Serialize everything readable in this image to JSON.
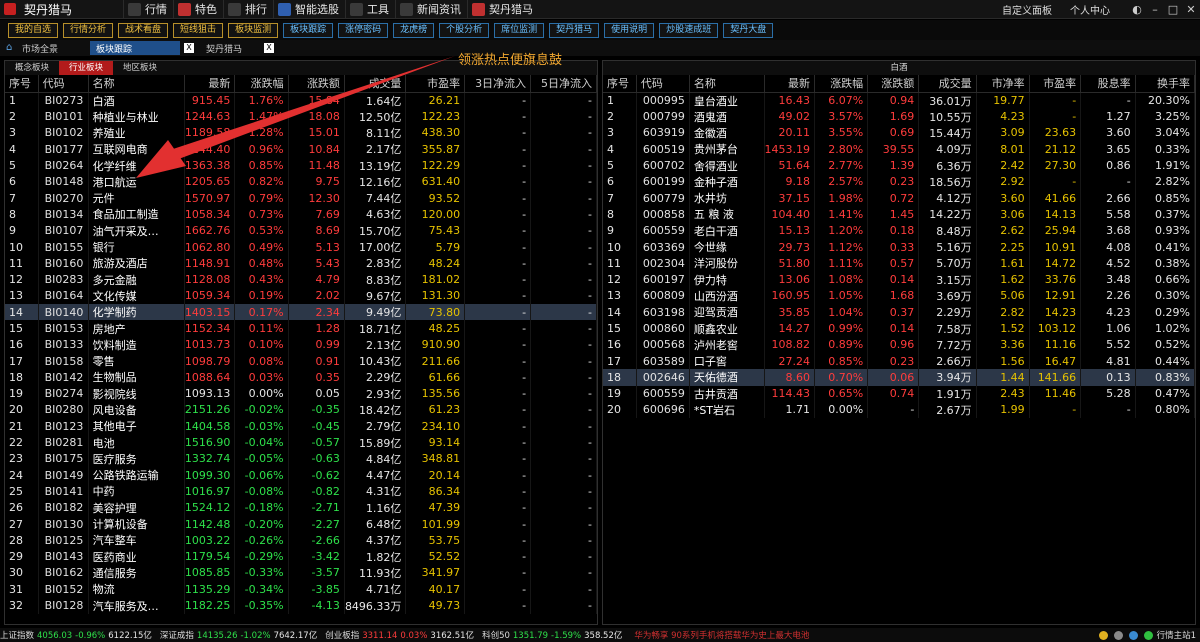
{
  "app": {
    "title": "契丹猎马"
  },
  "menu": [
    {
      "label": "行情",
      "icon": "chart-icon",
      "color": "#3a3a3a"
    },
    {
      "label": "特色",
      "icon": "star-icon",
      "color": "#c03030"
    },
    {
      "label": "排行",
      "icon": "rank-icon",
      "color": "#3a3a3a"
    },
    {
      "label": "智能选股",
      "icon": "smart-pick-icon",
      "color": "#2f5fb0"
    },
    {
      "label": "工具",
      "icon": "tool-icon",
      "color": "#3a3a3a"
    },
    {
      "label": "新闻资讯",
      "icon": "news-icon",
      "color": "#3a3a3a"
    },
    {
      "label": "契丹猎马",
      "icon": "brand-icon",
      "color": "#c03030"
    }
  ],
  "topright": {
    "custom_panel": "自定义面板",
    "personal": "个人中心"
  },
  "toolbar": [
    {
      "label": "我的自选",
      "style": "gold"
    },
    {
      "label": "行情分析",
      "style": "gold"
    },
    {
      "label": "战术看盘",
      "style": "gold"
    },
    {
      "label": "短线狙击",
      "style": "gold"
    },
    {
      "label": "板块监测",
      "style": "gold"
    },
    {
      "label": "板块跟踪",
      "style": "blue"
    },
    {
      "label": "涨停密码",
      "style": "blue"
    },
    {
      "label": "龙虎榜",
      "style": "blue"
    },
    {
      "label": "个股分析",
      "style": "blue"
    },
    {
      "label": "席位监测",
      "style": "blue"
    },
    {
      "label": "契丹猎马",
      "style": "blue"
    },
    {
      "label": "使用说明",
      "style": "blue"
    },
    {
      "label": "炒股速成班",
      "style": "blue"
    },
    {
      "label": "契丹大盘",
      "style": "blue"
    }
  ],
  "tabs": {
    "home": "市场全景",
    "active": "板块跟踪",
    "other": "契丹猎马"
  },
  "annotation": "领涨热点便旗息鼓",
  "left": {
    "subtabs": [
      "概念板块",
      "行业板块",
      "地区板块"
    ],
    "active_subtab": 1,
    "headers": [
      "序号",
      "代码",
      "名称",
      "最新",
      "涨跌幅",
      "涨跌额",
      "成交量",
      "市盈率",
      "3日净流入",
      "5日净流入"
    ],
    "rows": [
      [
        "1",
        "BI0273",
        "白酒",
        "915.45",
        "1.76%",
        "15.84",
        "1.64亿",
        "26.21",
        "-",
        "-"
      ],
      [
        "2",
        "BI0101",
        "种植业与林业",
        "1244.63",
        "1.47%",
        "18.08",
        "12.50亿",
        "122.23",
        "-",
        "-"
      ],
      [
        "3",
        "BI0102",
        "养殖业",
        "1189.58",
        "1.28%",
        "15.01",
        "8.11亿",
        "438.30",
        "-",
        "-"
      ],
      [
        "4",
        "BI0177",
        "互联网电商",
        "1144.40",
        "0.96%",
        "10.84",
        "2.17亿",
        "355.87",
        "-",
        "-"
      ],
      [
        "5",
        "BI0264",
        "化学纤维",
        "1363.38",
        "0.85%",
        "11.48",
        "13.19亿",
        "122.29",
        "-",
        "-"
      ],
      [
        "6",
        "BI0148",
        "港口航运",
        "1205.65",
        "0.82%",
        "9.75",
        "12.16亿",
        "631.40",
        "-",
        "-"
      ],
      [
        "7",
        "BI0270",
        "元件",
        "1570.97",
        "0.79%",
        "12.30",
        "7.44亿",
        "93.52",
        "-",
        "-"
      ],
      [
        "8",
        "BI0134",
        "食品加工制造",
        "1058.34",
        "0.73%",
        "7.69",
        "4.63亿",
        "120.00",
        "-",
        "-"
      ],
      [
        "9",
        "BI0107",
        "油气开采及…",
        "1662.76",
        "0.53%",
        "8.69",
        "15.70亿",
        "75.43",
        "-",
        "-"
      ],
      [
        "10",
        "BI0155",
        "银行",
        "1062.80",
        "0.49%",
        "5.13",
        "17.00亿",
        "5.79",
        "-",
        "-"
      ],
      [
        "11",
        "BI0160",
        "旅游及酒店",
        "1148.91",
        "0.48%",
        "5.43",
        "2.83亿",
        "48.24",
        "-",
        "-"
      ],
      [
        "12",
        "BI0283",
        "多元金融",
        "1128.08",
        "0.43%",
        "4.79",
        "8.83亿",
        "181.02",
        "-",
        "-"
      ],
      [
        "13",
        "BI0164",
        "文化传媒",
        "1059.34",
        "0.19%",
        "2.02",
        "9.67亿",
        "131.30",
        "-",
        "-"
      ],
      [
        "14",
        "BI0140",
        "化学制药",
        "1403.15",
        "0.17%",
        "2.34",
        "9.49亿",
        "73.80",
        "-",
        "-"
      ],
      [
        "15",
        "BI0153",
        "房地产",
        "1152.34",
        "0.11%",
        "1.28",
        "18.71亿",
        "48.25",
        "-",
        "-"
      ],
      [
        "16",
        "BI0133",
        "饮料制造",
        "1013.73",
        "0.10%",
        "0.99",
        "2.13亿",
        "910.90",
        "-",
        "-"
      ],
      [
        "17",
        "BI0158",
        "零售",
        "1098.79",
        "0.08%",
        "0.91",
        "10.43亿",
        "211.66",
        "-",
        "-"
      ],
      [
        "18",
        "BI0142",
        "生物制品",
        "1088.64",
        "0.03%",
        "0.35",
        "2.29亿",
        "61.66",
        "-",
        "-"
      ],
      [
        "19",
        "BI0274",
        "影视院线",
        "1093.13",
        "0.00%",
        "0.05",
        "2.93亿",
        "135.56",
        "-",
        "-"
      ],
      [
        "20",
        "BI0280",
        "风电设备",
        "2151.26",
        "-0.02%",
        "-0.35",
        "18.42亿",
        "61.23",
        "-",
        "-"
      ],
      [
        "21",
        "BI0123",
        "其他电子",
        "1404.58",
        "-0.03%",
        "-0.45",
        "2.79亿",
        "234.10",
        "-",
        "-"
      ],
      [
        "22",
        "BI0281",
        "电池",
        "1516.90",
        "-0.04%",
        "-0.57",
        "15.89亿",
        "93.14",
        "-",
        "-"
      ],
      [
        "23",
        "BI0175",
        "医疗服务",
        "1332.74",
        "-0.05%",
        "-0.63",
        "4.84亿",
        "348.81",
        "-",
        "-"
      ],
      [
        "24",
        "BI0149",
        "公路铁路运输",
        "1099.30",
        "-0.06%",
        "-0.62",
        "4.47亿",
        "20.14",
        "-",
        "-"
      ],
      [
        "25",
        "BI0141",
        "中药",
        "1016.97",
        "-0.08%",
        "-0.82",
        "4.31亿",
        "86.34",
        "-",
        "-"
      ],
      [
        "26",
        "BI0182",
        "美容护理",
        "1524.12",
        "-0.18%",
        "-2.71",
        "1.16亿",
        "47.39",
        "-",
        "-"
      ],
      [
        "27",
        "BI0130",
        "计算机设备",
        "1142.48",
        "-0.20%",
        "-2.27",
        "6.48亿",
        "101.99",
        "-",
        "-"
      ],
      [
        "28",
        "BI0125",
        "汽车整车",
        "1003.22",
        "-0.26%",
        "-2.66",
        "4.37亿",
        "53.75",
        "-",
        "-"
      ],
      [
        "29",
        "BI0143",
        "医药商业",
        "1179.54",
        "-0.29%",
        "-3.42",
        "1.82亿",
        "52.52",
        "-",
        "-"
      ],
      [
        "30",
        "BI0162",
        "通信服务",
        "1085.85",
        "-0.33%",
        "-3.57",
        "11.93亿",
        "341.97",
        "-",
        "-"
      ],
      [
        "31",
        "BI0152",
        "物流",
        "1135.29",
        "-0.34%",
        "-3.85",
        "4.71亿",
        "40.17",
        "-",
        "-"
      ],
      [
        "32",
        "BI0128",
        "汽车服务及…",
        "1182.25",
        "-0.35%",
        "-4.13",
        "8496.33万",
        "49.73",
        "-",
        "-"
      ]
    ],
    "selected_row": 13
  },
  "right": {
    "title": "白酒",
    "headers": [
      "序号",
      "代码",
      "名称",
      "最新",
      "涨跌幅",
      "涨跌额",
      "成交量",
      "市净率",
      "市盈率",
      "股息率",
      "换手率"
    ],
    "rows": [
      [
        "1",
        "000995",
        "皇台酒业",
        "16.43",
        "6.07%",
        "0.94",
        "36.01万",
        "19.77",
        "-",
        "-",
        "20.30%"
      ],
      [
        "2",
        "000799",
        "酒鬼酒",
        "49.02",
        "3.57%",
        "1.69",
        "10.55万",
        "4.23",
        "-",
        "1.27",
        "3.25%"
      ],
      [
        "3",
        "603919",
        "金徽酒",
        "20.11",
        "3.55%",
        "0.69",
        "15.44万",
        "3.09",
        "23.63",
        "3.60",
        "3.04%"
      ],
      [
        "4",
        "600519",
        "贵州茅台",
        "1453.19",
        "2.80%",
        "39.55",
        "4.09万",
        "8.01",
        "21.12",
        "3.65",
        "0.33%"
      ],
      [
        "5",
        "600702",
        "舍得酒业",
        "51.64",
        "2.77%",
        "1.39",
        "6.36万",
        "2.42",
        "27.30",
        "0.86",
        "1.91%"
      ],
      [
        "6",
        "600199",
        "金种子酒",
        "9.18",
        "2.57%",
        "0.23",
        "18.56万",
        "2.92",
        "-",
        "-",
        "2.82%"
      ],
      [
        "7",
        "600779",
        "水井坊",
        "37.15",
        "1.98%",
        "0.72",
        "4.12万",
        "3.60",
        "41.66",
        "2.66",
        "0.85%"
      ],
      [
        "8",
        "000858",
        "五 粮 液",
        "104.40",
        "1.41%",
        "1.45",
        "14.22万",
        "3.06",
        "14.13",
        "5.58",
        "0.37%"
      ],
      [
        "9",
        "600559",
        "老白干酒",
        "15.13",
        "1.20%",
        "0.18",
        "8.48万",
        "2.62",
        "25.94",
        "3.68",
        "0.93%"
      ],
      [
        "10",
        "603369",
        "今世缘",
        "29.73",
        "1.12%",
        "0.33",
        "5.16万",
        "2.25",
        "10.91",
        "4.08",
        "0.41%"
      ],
      [
        "11",
        "002304",
        "洋河股份",
        "51.80",
        "1.11%",
        "0.57",
        "5.70万",
        "1.61",
        "14.72",
        "4.52",
        "0.38%"
      ],
      [
        "12",
        "600197",
        "伊力特",
        "13.06",
        "1.08%",
        "0.14",
        "3.15万",
        "1.62",
        "33.76",
        "3.48",
        "0.66%"
      ],
      [
        "13",
        "600809",
        "山西汾酒",
        "160.95",
        "1.05%",
        "1.68",
        "3.69万",
        "5.06",
        "12.91",
        "2.26",
        "0.30%"
      ],
      [
        "14",
        "603198",
        "迎驾贡酒",
        "35.85",
        "1.04%",
        "0.37",
        "2.29万",
        "2.82",
        "14.23",
        "4.23",
        "0.29%"
      ],
      [
        "15",
        "000860",
        "顺鑫农业",
        "14.27",
        "0.99%",
        "0.14",
        "7.58万",
        "1.52",
        "103.12",
        "1.06",
        "1.02%"
      ],
      [
        "16",
        "000568",
        "泸州老窖",
        "108.82",
        "0.89%",
        "0.96",
        "7.72万",
        "3.36",
        "11.16",
        "5.52",
        "0.52%"
      ],
      [
        "17",
        "603589",
        "口子窖",
        "27.24",
        "0.85%",
        "0.23",
        "2.66万",
        "1.56",
        "16.47",
        "4.81",
        "0.44%"
      ],
      [
        "18",
        "002646",
        "天佑德酒",
        "8.60",
        "0.70%",
        "0.06",
        "3.94万",
        "1.44",
        "141.66",
        "0.13",
        "0.83%"
      ],
      [
        "19",
        "600559",
        "古井贡酒",
        "114.43",
        "0.65%",
        "0.74",
        "1.91万",
        "2.43",
        "11.46",
        "5.28",
        "0.47%"
      ],
      [
        "20",
        "600696",
        "*ST岩石",
        "1.71",
        "0.00%",
        "-",
        "2.67万",
        "1.99",
        "-",
        "-",
        "0.80%"
      ]
    ],
    "selected_row": 17
  },
  "statusbar": [
    {
      "name": "上证指数",
      "value": "4056.03",
      "pct": "-0.96%",
      "amount": "6122.15亿"
    },
    {
      "name": "深证成指",
      "value": "14135.26",
      "pct": "-1.02%",
      "amount": "7642.17亿"
    },
    {
      "name": "创业板指",
      "value": "3311.14",
      "pct": "0.03%",
      "amount": "3162.51亿"
    },
    {
      "name": "科创50",
      "value": "1351.79",
      "pct": "-1.59%",
      "amount": "358.52亿"
    }
  ],
  "ticker": "华为畅享 90系列手机将搭载华为史上最大电池",
  "status_right": "行情主站1"
}
